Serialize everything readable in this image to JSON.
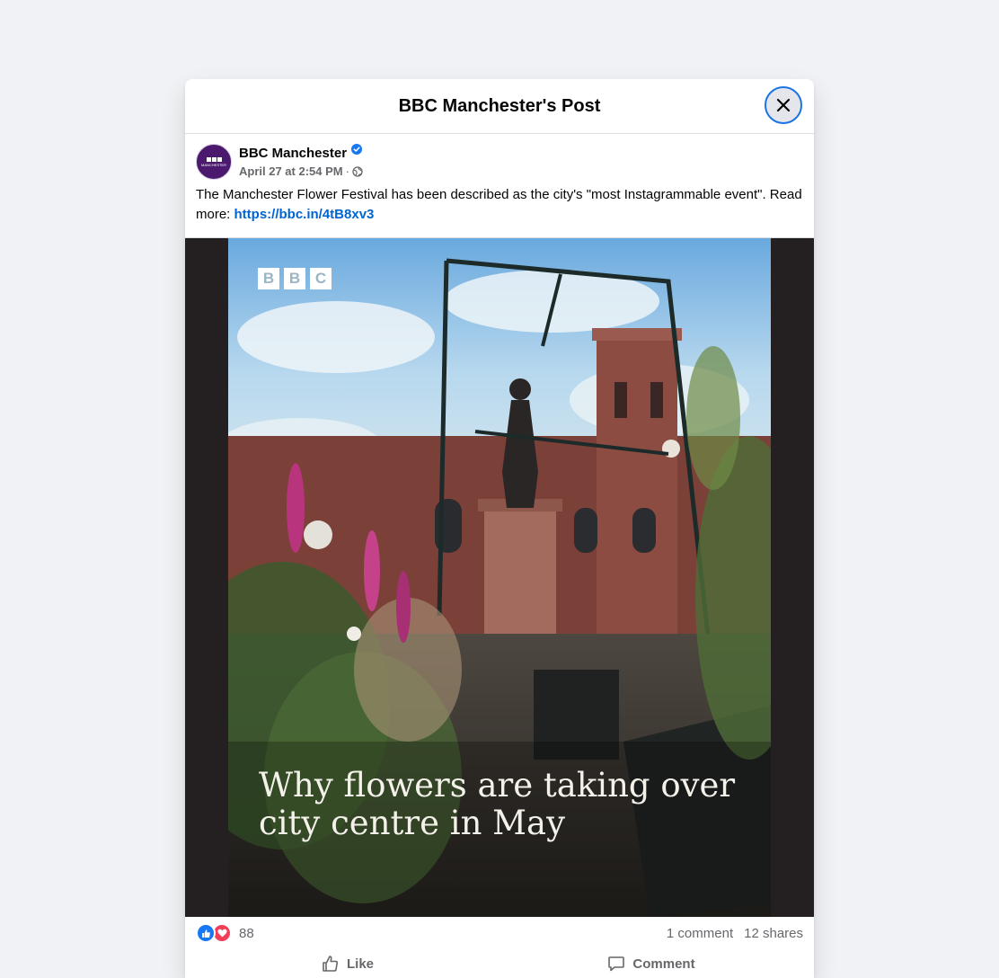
{
  "modal": {
    "title": "BBC Manchester's Post"
  },
  "post": {
    "page_name": "BBC Manchester",
    "avatar_text": "MANCHESTER",
    "date": "April 27 at 2:54 PM",
    "separator": "·",
    "audience_icon": "globe-icon",
    "text": "The Manchester Flower Festival has been described as the city's \"most Instagrammable event\". Read more:",
    "link": "https://bbc.in/4tB8xv3"
  },
  "media": {
    "logo_letters": [
      "B",
      "B",
      "C"
    ],
    "caption_line1": "Why flowers are taking over",
    "caption_line2": "city centre in May"
  },
  "stats": {
    "reaction_count": "88",
    "comments": "1 comment",
    "shares": "12 shares"
  },
  "actions": {
    "like_label": "Like",
    "comment_label": "Comment"
  },
  "colors": {
    "link": "#0064d1",
    "like_blue": "#1877f2",
    "love_red": "#f33e58",
    "avatar_purple": "#4b1a6f"
  }
}
